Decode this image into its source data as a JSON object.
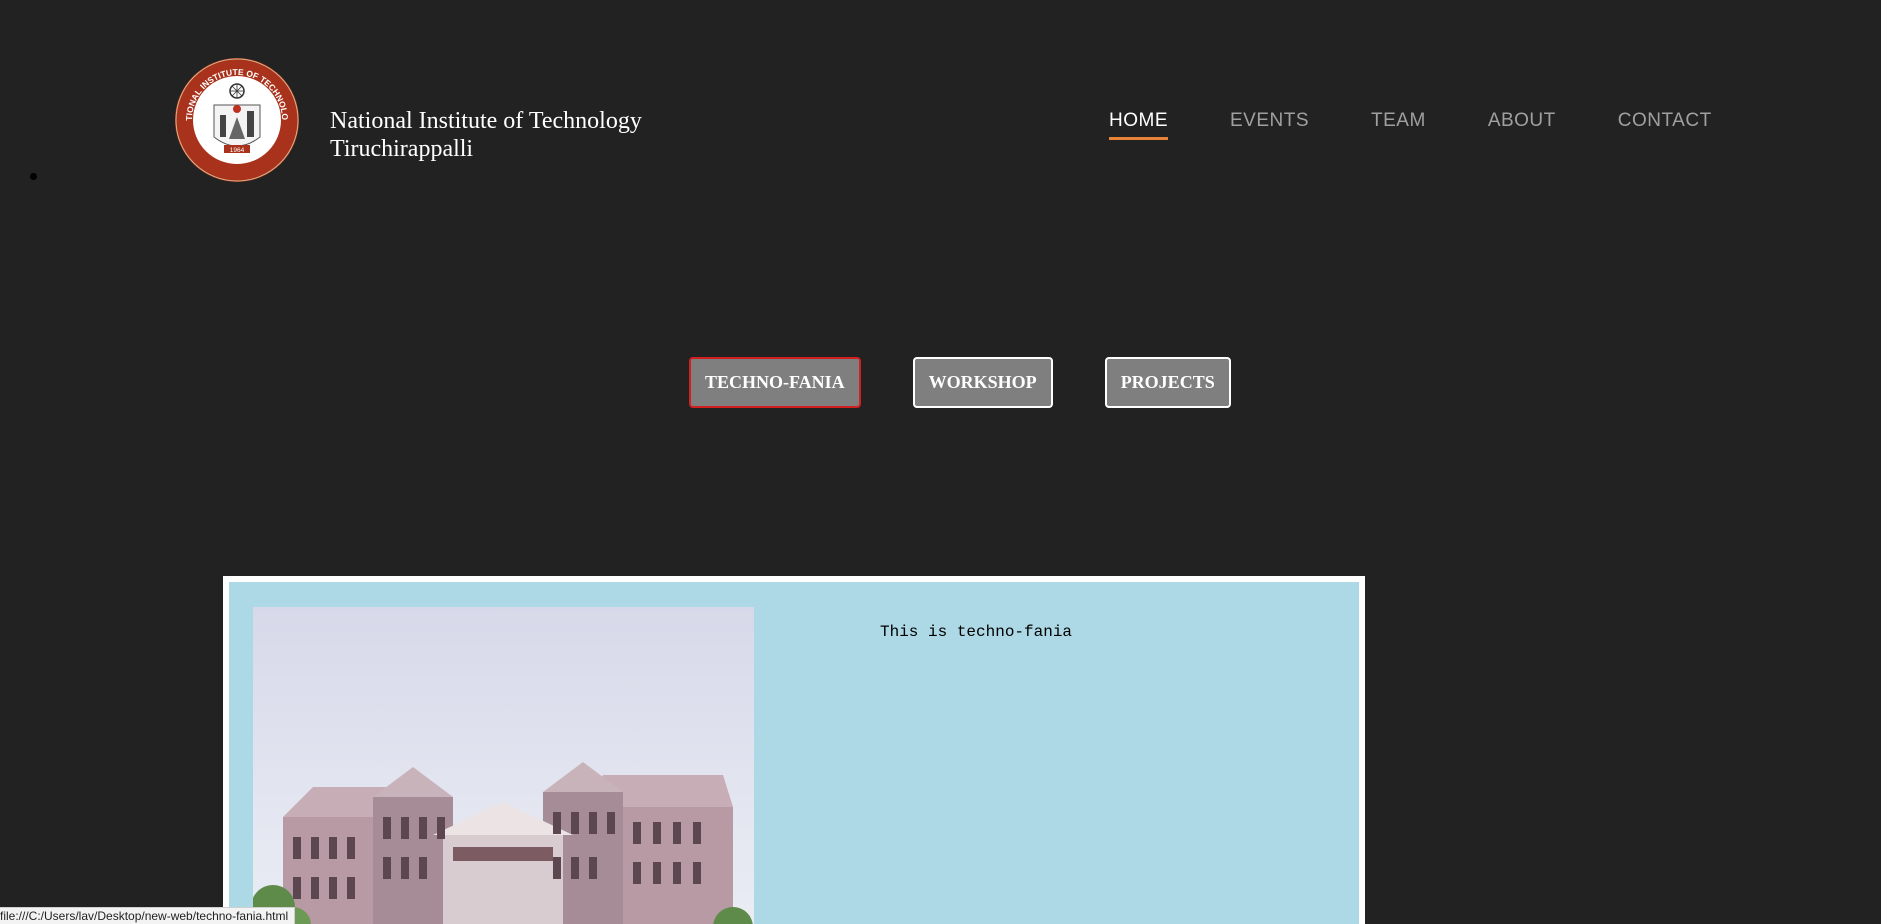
{
  "header": {
    "logo_label": "NIT Trichy emblem",
    "logo_text_top": "NATIONAL INSTITUTE OF TECHNOLOGY",
    "logo_text_bottom": "TIRUCHIRAPPALLI",
    "logo_year": "1964",
    "title_line1": "National Institute of Technology",
    "title_line2": "Tiruchirappalli"
  },
  "nav": {
    "items": [
      {
        "label": "HOME",
        "active": true
      },
      {
        "label": "EVENTS",
        "active": false
      },
      {
        "label": "TEAM",
        "active": false
      },
      {
        "label": "ABOUT",
        "active": false
      },
      {
        "label": "CONTACT",
        "active": false
      }
    ]
  },
  "tabs": {
    "items": [
      {
        "label": "TECHNO-FANIA",
        "active": true
      },
      {
        "label": "WORKSHOP",
        "active": false
      },
      {
        "label": "PROJECTS",
        "active": false
      }
    ]
  },
  "panel": {
    "text": "This is techno-fania",
    "image_label": "campus building photo"
  },
  "status_bar": {
    "url": "file:///C:/Users/lav/Desktop/new-web/techno-fania.html"
  },
  "colors": {
    "background": "#222222",
    "nav_active_underline": "#e8833a",
    "tab_active_border": "#d21f1f",
    "panel_bg": "#add8e6",
    "emblem_red": "#a8321c"
  }
}
